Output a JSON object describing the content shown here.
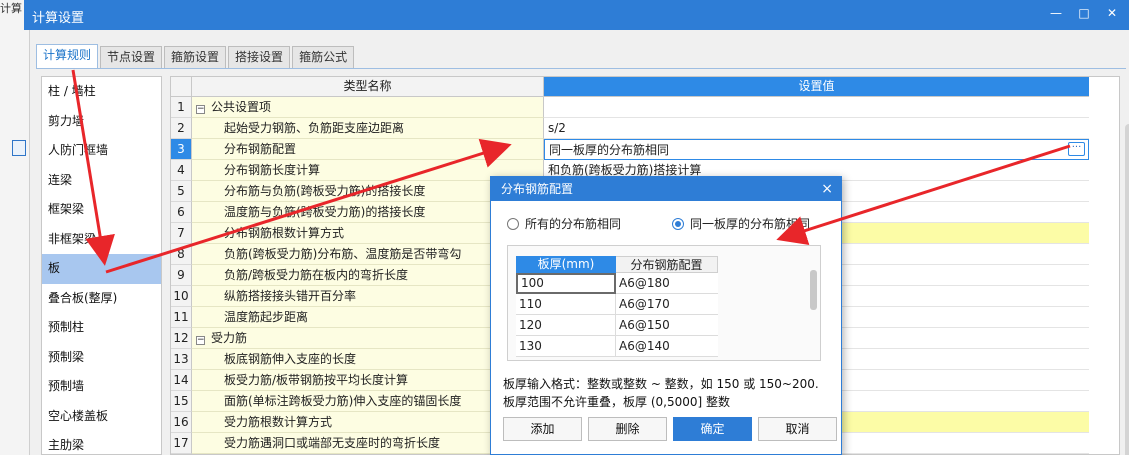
{
  "window": {
    "title": "计算设置",
    "bg_label": "计算"
  },
  "tabs": [
    "计算规则",
    "节点设置",
    "箍筋设置",
    "搭接设置",
    "箍筋公式"
  ],
  "left_items": [
    "柱 / 墙柱",
    "剪力墙",
    "人防门框墙",
    "连梁",
    "框架梁",
    "非框架梁",
    "板",
    "叠合板(整厚)",
    "预制柱",
    "预制梁",
    "预制墙",
    "空心楼盖板",
    "主肋梁"
  ],
  "grid": {
    "col_name": "类型名称",
    "col_value": "设置值",
    "rows": [
      {
        "n": "1",
        "name": "公共设置项",
        "value": ""
      },
      {
        "n": "2",
        "name": "起始受力钢筋、负筋距支座边距离",
        "value": "s/2"
      },
      {
        "n": "3",
        "name": "分布钢筋配置",
        "value": "同一板厚的分布筋相同"
      },
      {
        "n": "4",
        "name": "分布钢筋长度计算",
        "value": "和负筋(跨板受力筋)搭接计算"
      },
      {
        "n": "5",
        "name": "分布筋与负筋(跨板受力筋)的搭接长度",
        "value": ""
      },
      {
        "n": "6",
        "name": "温度筋与负筋(跨板受力筋)的搭接长度",
        "value": ""
      },
      {
        "n": "7",
        "name": "分布钢筋根数计算方式",
        "value": ""
      },
      {
        "n": "8",
        "name": "负筋(跨板受力筋)分布筋、温度筋是否带弯勾",
        "value": ""
      },
      {
        "n": "9",
        "name": "负筋/跨板受力筋在板内的弯折长度",
        "value": ""
      },
      {
        "n": "10",
        "name": "纵筋搭接接头错开百分率",
        "value": ""
      },
      {
        "n": "11",
        "name": "温度筋起步距离",
        "value": ""
      },
      {
        "n": "12",
        "name": "受力筋",
        "value": ""
      },
      {
        "n": "13",
        "name": "板底钢筋伸入支座的长度",
        "value": ""
      },
      {
        "n": "14",
        "name": "板受力筋/板带钢筋按平均长度计算",
        "value": ""
      },
      {
        "n": "15",
        "name": "面筋(单标注跨板受力筋)伸入支座的锚固长度",
        "value": ""
      },
      {
        "n": "16",
        "name": "受力筋根数计算方式",
        "value": ""
      },
      {
        "n": "17",
        "name": "受力筋遇洞口或端部无支座时的弯折长度",
        "value": ""
      }
    ]
  },
  "dialog": {
    "title": "分布钢筋配置",
    "close": "×",
    "radio_all": "所有的分布筋相同",
    "radio_same": "同一板厚的分布筋相同",
    "table": {
      "col1": "板厚(mm)",
      "col2": "分布钢筋配置",
      "rows": [
        {
          "thick": "100",
          "config": "A6@180"
        },
        {
          "thick": "110",
          "config": "A6@170"
        },
        {
          "thick": "120",
          "config": "A6@150"
        },
        {
          "thick": "130",
          "config": "A6@140"
        }
      ]
    },
    "hint1": "板厚输入格式：整数或整数 ~ 整数，如 150 或 150~200.",
    "hint2": "板厚范围不允许重叠，板厚 (0,5000] 整数",
    "buttons": {
      "add": "添加",
      "delete": "删除",
      "ok": "确定",
      "cancel": "取消"
    }
  }
}
